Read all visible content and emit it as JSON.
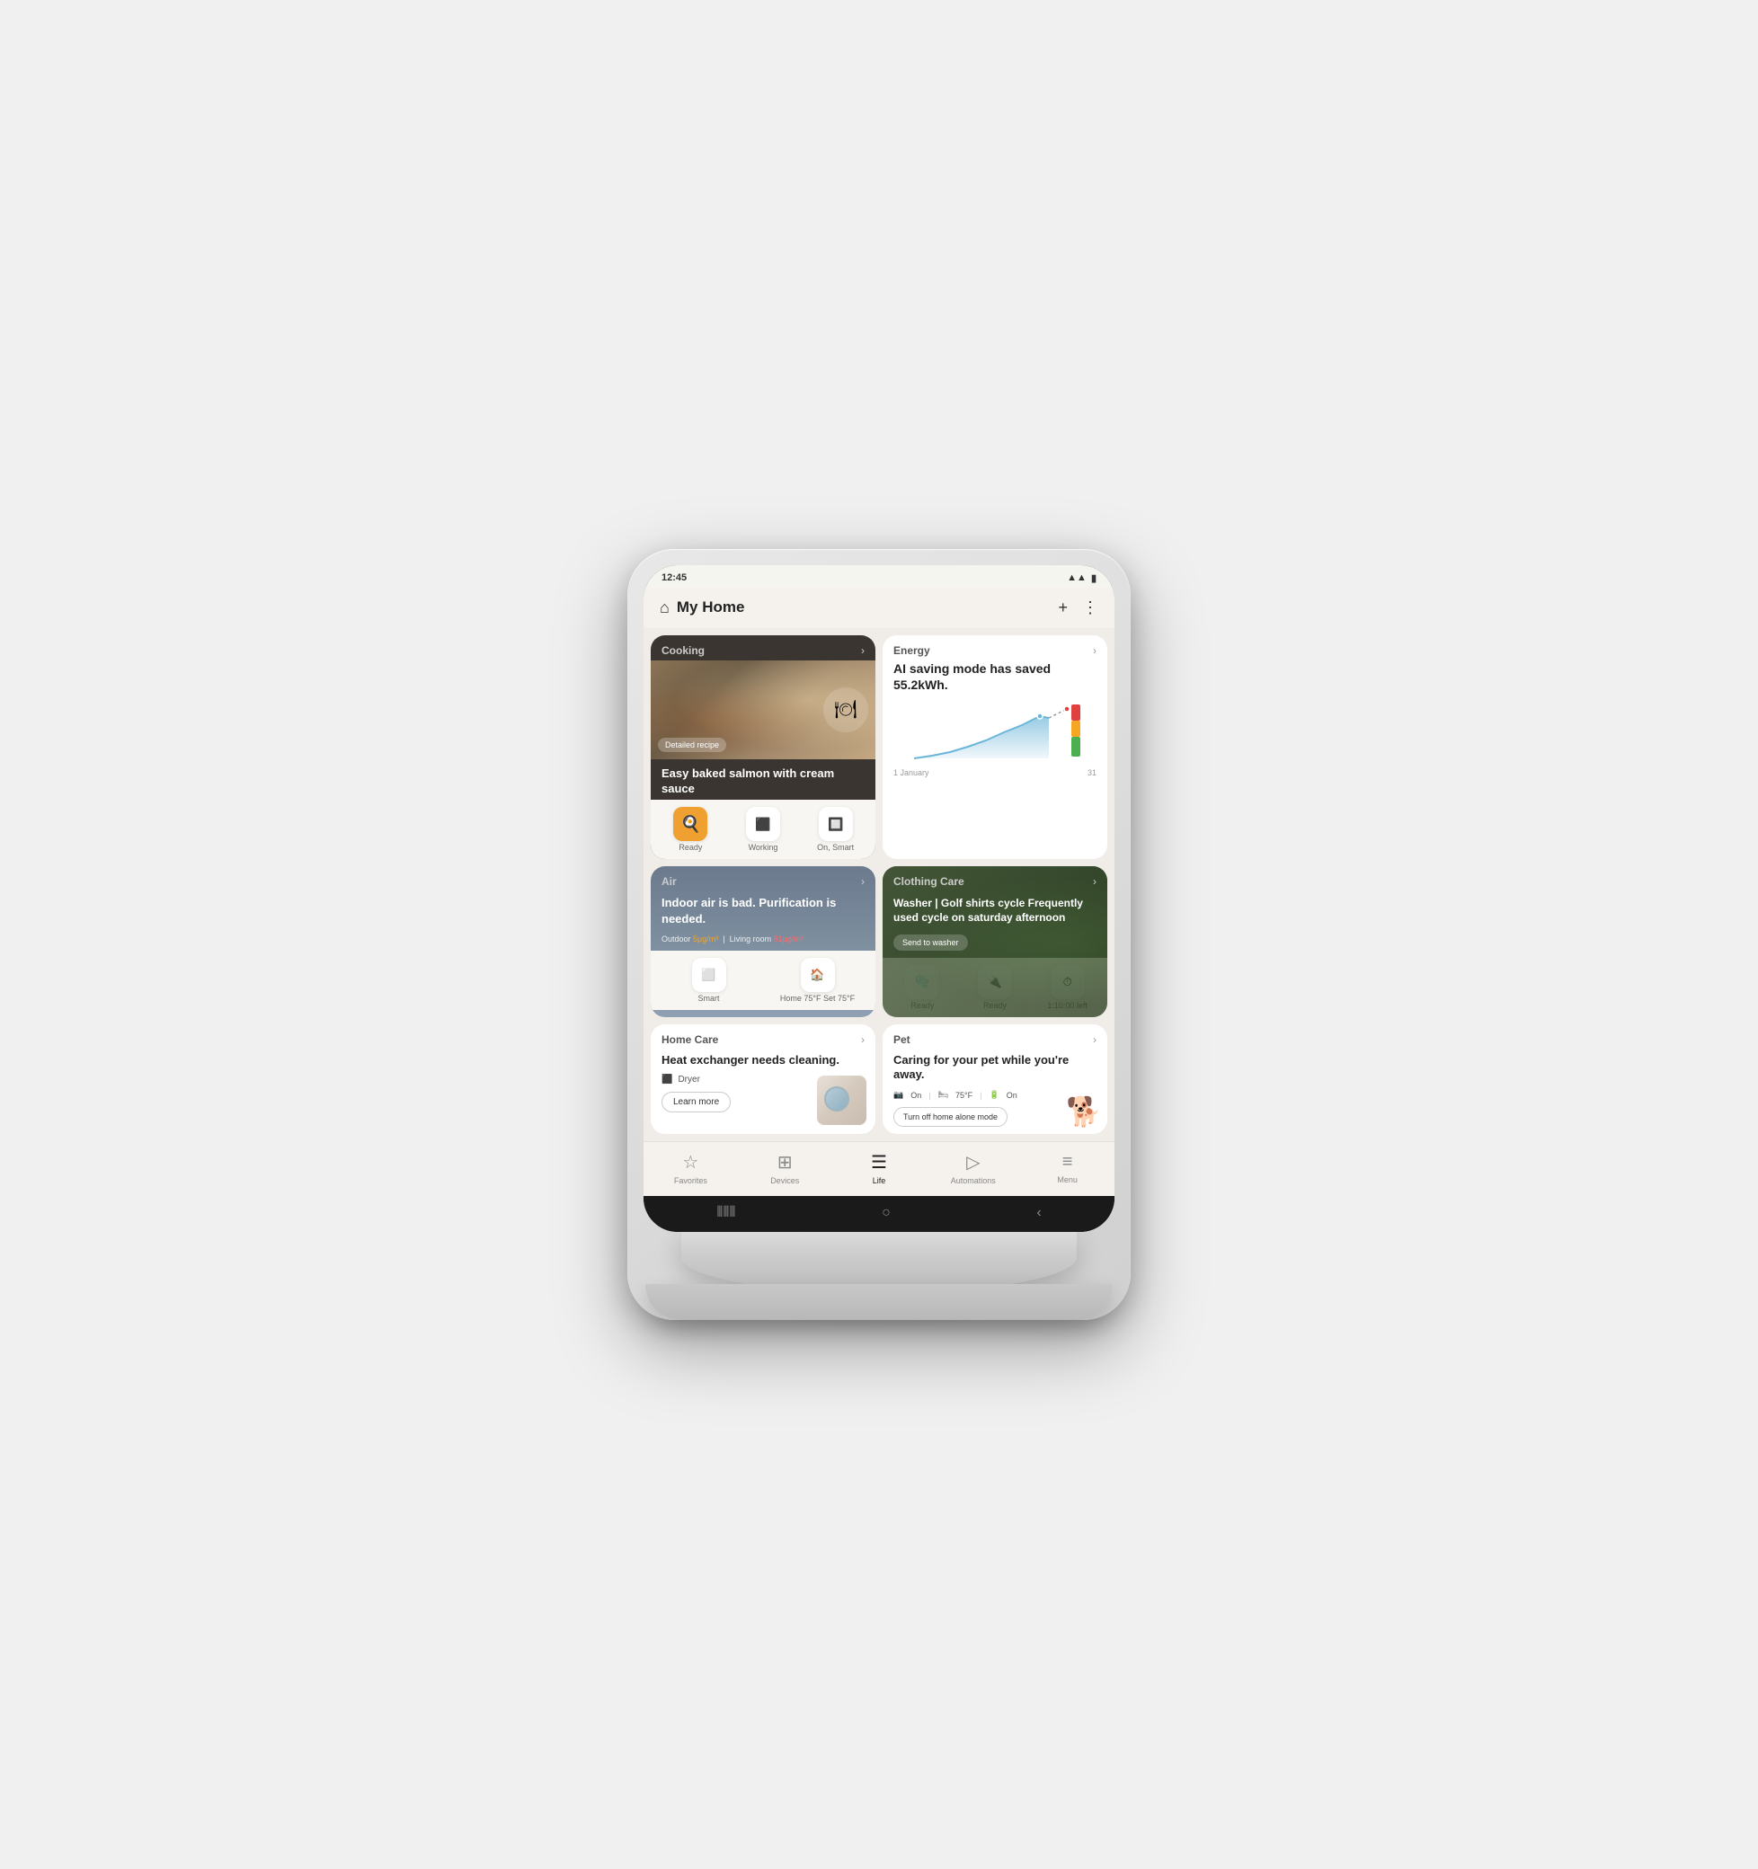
{
  "statusBar": {
    "time": "12:45",
    "signal": "▲",
    "battery": "🔋"
  },
  "header": {
    "title": "My Home",
    "addBtn": "+",
    "menuBtn": "⋮"
  },
  "cooking": {
    "label": "Cooking",
    "title": "Easy baked salmon with cream sauce",
    "recipeBadge": "Detailed recipe",
    "devices": [
      {
        "icon": "🟧",
        "status": "Ready",
        "active": true
      },
      {
        "icon": "🔲",
        "status": "Working",
        "active": false
      },
      {
        "icon": "🔲",
        "status": "On, Smart",
        "active": false
      }
    ]
  },
  "energy": {
    "label": "Energy",
    "title": "AI saving mode has saved 55.2kWh.",
    "chartStart": "1 January",
    "chartEnd": "31"
  },
  "air": {
    "label": "Air",
    "message": "Indoor air is bad. Purification is needed.",
    "outdoor": "5μg/m³",
    "livingRoom": "81μg/m³",
    "devices": [
      {
        "icon": "🔲",
        "status": "Smart"
      },
      {
        "icon": "🔲",
        "status": "Home 75°F Set 75°F"
      }
    ]
  },
  "clothing": {
    "label": "Clothing Care",
    "title": "Washer | Golf shirts cycle Frequently used cycle on saturday afternoon",
    "sendBtn": "Send to washer",
    "devices": [
      {
        "icon": "🔲",
        "status": "Ready"
      },
      {
        "icon": "🔲",
        "status": "Ready"
      },
      {
        "icon": "🔲",
        "status": "1:10:00 left"
      }
    ]
  },
  "homeCare": {
    "label": "Home Care",
    "title": "Heat exchanger needs cleaning.",
    "device": "Dryer",
    "learnMore": "Learn more"
  },
  "pet": {
    "label": "Pet",
    "title": "Caring for your pet while you're away.",
    "stats": [
      {
        "label": "On",
        "icon": "🔲"
      },
      {
        "label": "75°F",
        "icon": "🛏"
      },
      {
        "label": "On",
        "icon": "🔋"
      }
    ],
    "turnOffBtn": "Turn off home alone mode"
  },
  "bottomNav": {
    "items": [
      {
        "icon": "☆",
        "label": "Favorites",
        "active": false
      },
      {
        "icon": "⊞",
        "label": "Devices",
        "active": false
      },
      {
        "icon": "☰",
        "label": "Life",
        "active": true
      },
      {
        "icon": "▷",
        "label": "Automations",
        "active": false
      },
      {
        "icon": "≡",
        "label": "Menu",
        "active": false
      }
    ]
  }
}
